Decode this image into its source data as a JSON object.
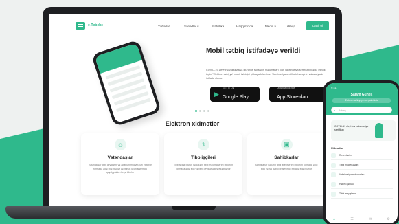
{
  "colors": {
    "accent": "#2fb98c",
    "dark": "#1e1f22"
  },
  "nav": {
    "logo": "e-Təbəbə",
    "items": [
      "Xəbərlər",
      "Sənədlər ▾",
      "Statistika",
      "Haqqımızda",
      "Media ▾",
      "Əlaqə"
    ],
    "login": "Daxil ol"
  },
  "hero": {
    "title": "Mobil tətbiq istifadəyə verildi",
    "description": "COVID-19 əleyhinə vaksinasiya olunmuş şəxslərin məlumatları olan vaksinasiya sertifikatını əldə etmək üçün \"Elektron səhiyyə\" mobil tətbiqini yükləyə bilərsiniz. Vaksinasiya sertifikatı həmçinin vakansiyada istifadə olunur.",
    "google_play": {
      "sub": "GET IT ON",
      "label": "Google Play"
    },
    "app_store": {
      "sub": "Download on the",
      "label": "App Store-dan"
    },
    "page_indicator": {
      "active_index": 0,
      "count": 4
    }
  },
  "services": {
    "title": "Elektron xidmətlər",
    "cards": [
      {
        "icon": "citizen-icon",
        "title": "Vətəndaşlar",
        "desc": "Vətəndaşlar tibbi qeydlərini və aparılan müayinələri elektron formada əldə edə bilərlər və bunun üçün sistemdə qeydiyyatdan keçə bilərlər"
      },
      {
        "icon": "stethoscope-icon",
        "title": "Tibb işçiləri",
        "desc": "Tibb işçiləri bütün xəstələrin tibbi məlumatlarını elektron formada əldə edə və yeni qeydlər əlavə edə bilərlər"
      },
      {
        "icon": "employer-icon",
        "title": "Sahibkarlar",
        "desc": "Sahibkarlar işçilərin tibbi arayışlarını elektron formada əldə edə və işə qəbul prosesində istifadə edə bilərlər"
      }
    ]
  },
  "mobile": {
    "status_time": "9:41",
    "greeting": "Salam Günel,",
    "subtitle": "Elektron səhiyyəyə xoş gəlmisiniz",
    "search_placeholder": "Axtarış...",
    "banner": "COVID-19 əleyhinə vaksinasiya sertifikatı",
    "section": "Xidmətlər",
    "items": [
      "Reseptlərim",
      "Tibbi müayinələrim",
      "Vaksinasiya məlumatları",
      "Həkim qəbulu",
      "Tibbi arayışlarım"
    ],
    "tabs": [
      "⌂",
      "☰",
      "✉",
      "⚙"
    ]
  }
}
